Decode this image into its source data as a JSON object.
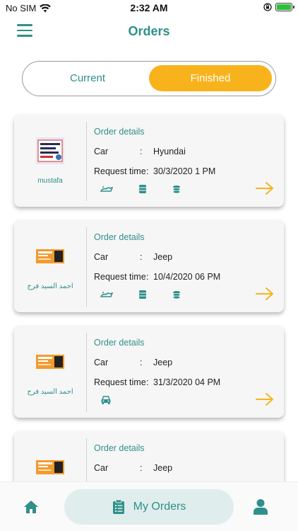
{
  "status_bar": {
    "carrier": "No SIM",
    "time": "2:32 AM"
  },
  "header": {
    "title": "Orders"
  },
  "tabs": {
    "current": "Current",
    "finished": "Finished"
  },
  "colors": {
    "primary": "#2f8f8a",
    "accent": "#f8b31c"
  },
  "orders": [
    {
      "customer": "mustafa",
      "details_title": "Order details",
      "car_label": "Car",
      "car": "Hyundai",
      "time_label": "Request time",
      "time": "30/3/2020 1 PM",
      "icons": [
        "car-wash-icon",
        "oil-barrel-icon",
        "coins-icon"
      ]
    },
    {
      "customer": "احمد السيد فرج",
      "details_title": "Order details",
      "car_label": "Car",
      "car": "Jeep",
      "time_label": "Request time",
      "time": "10/4/2020 06 PM",
      "icons": [
        "car-wash-icon",
        "oil-barrel-icon",
        "coins-icon"
      ]
    },
    {
      "customer": "احمد السيد فرج",
      "details_title": "Order details",
      "car_label": "Car",
      "car": "Jeep",
      "time_label": "Request time",
      "time": "31/3/2020 04 PM",
      "icons": [
        "car-front-icon"
      ]
    },
    {
      "customer": "",
      "details_title": "Order details",
      "car_label": "Car",
      "car": "Jeep",
      "time_label": "",
      "time": "",
      "icons": []
    }
  ],
  "bottom_nav": {
    "orders_label": "My Orders"
  }
}
